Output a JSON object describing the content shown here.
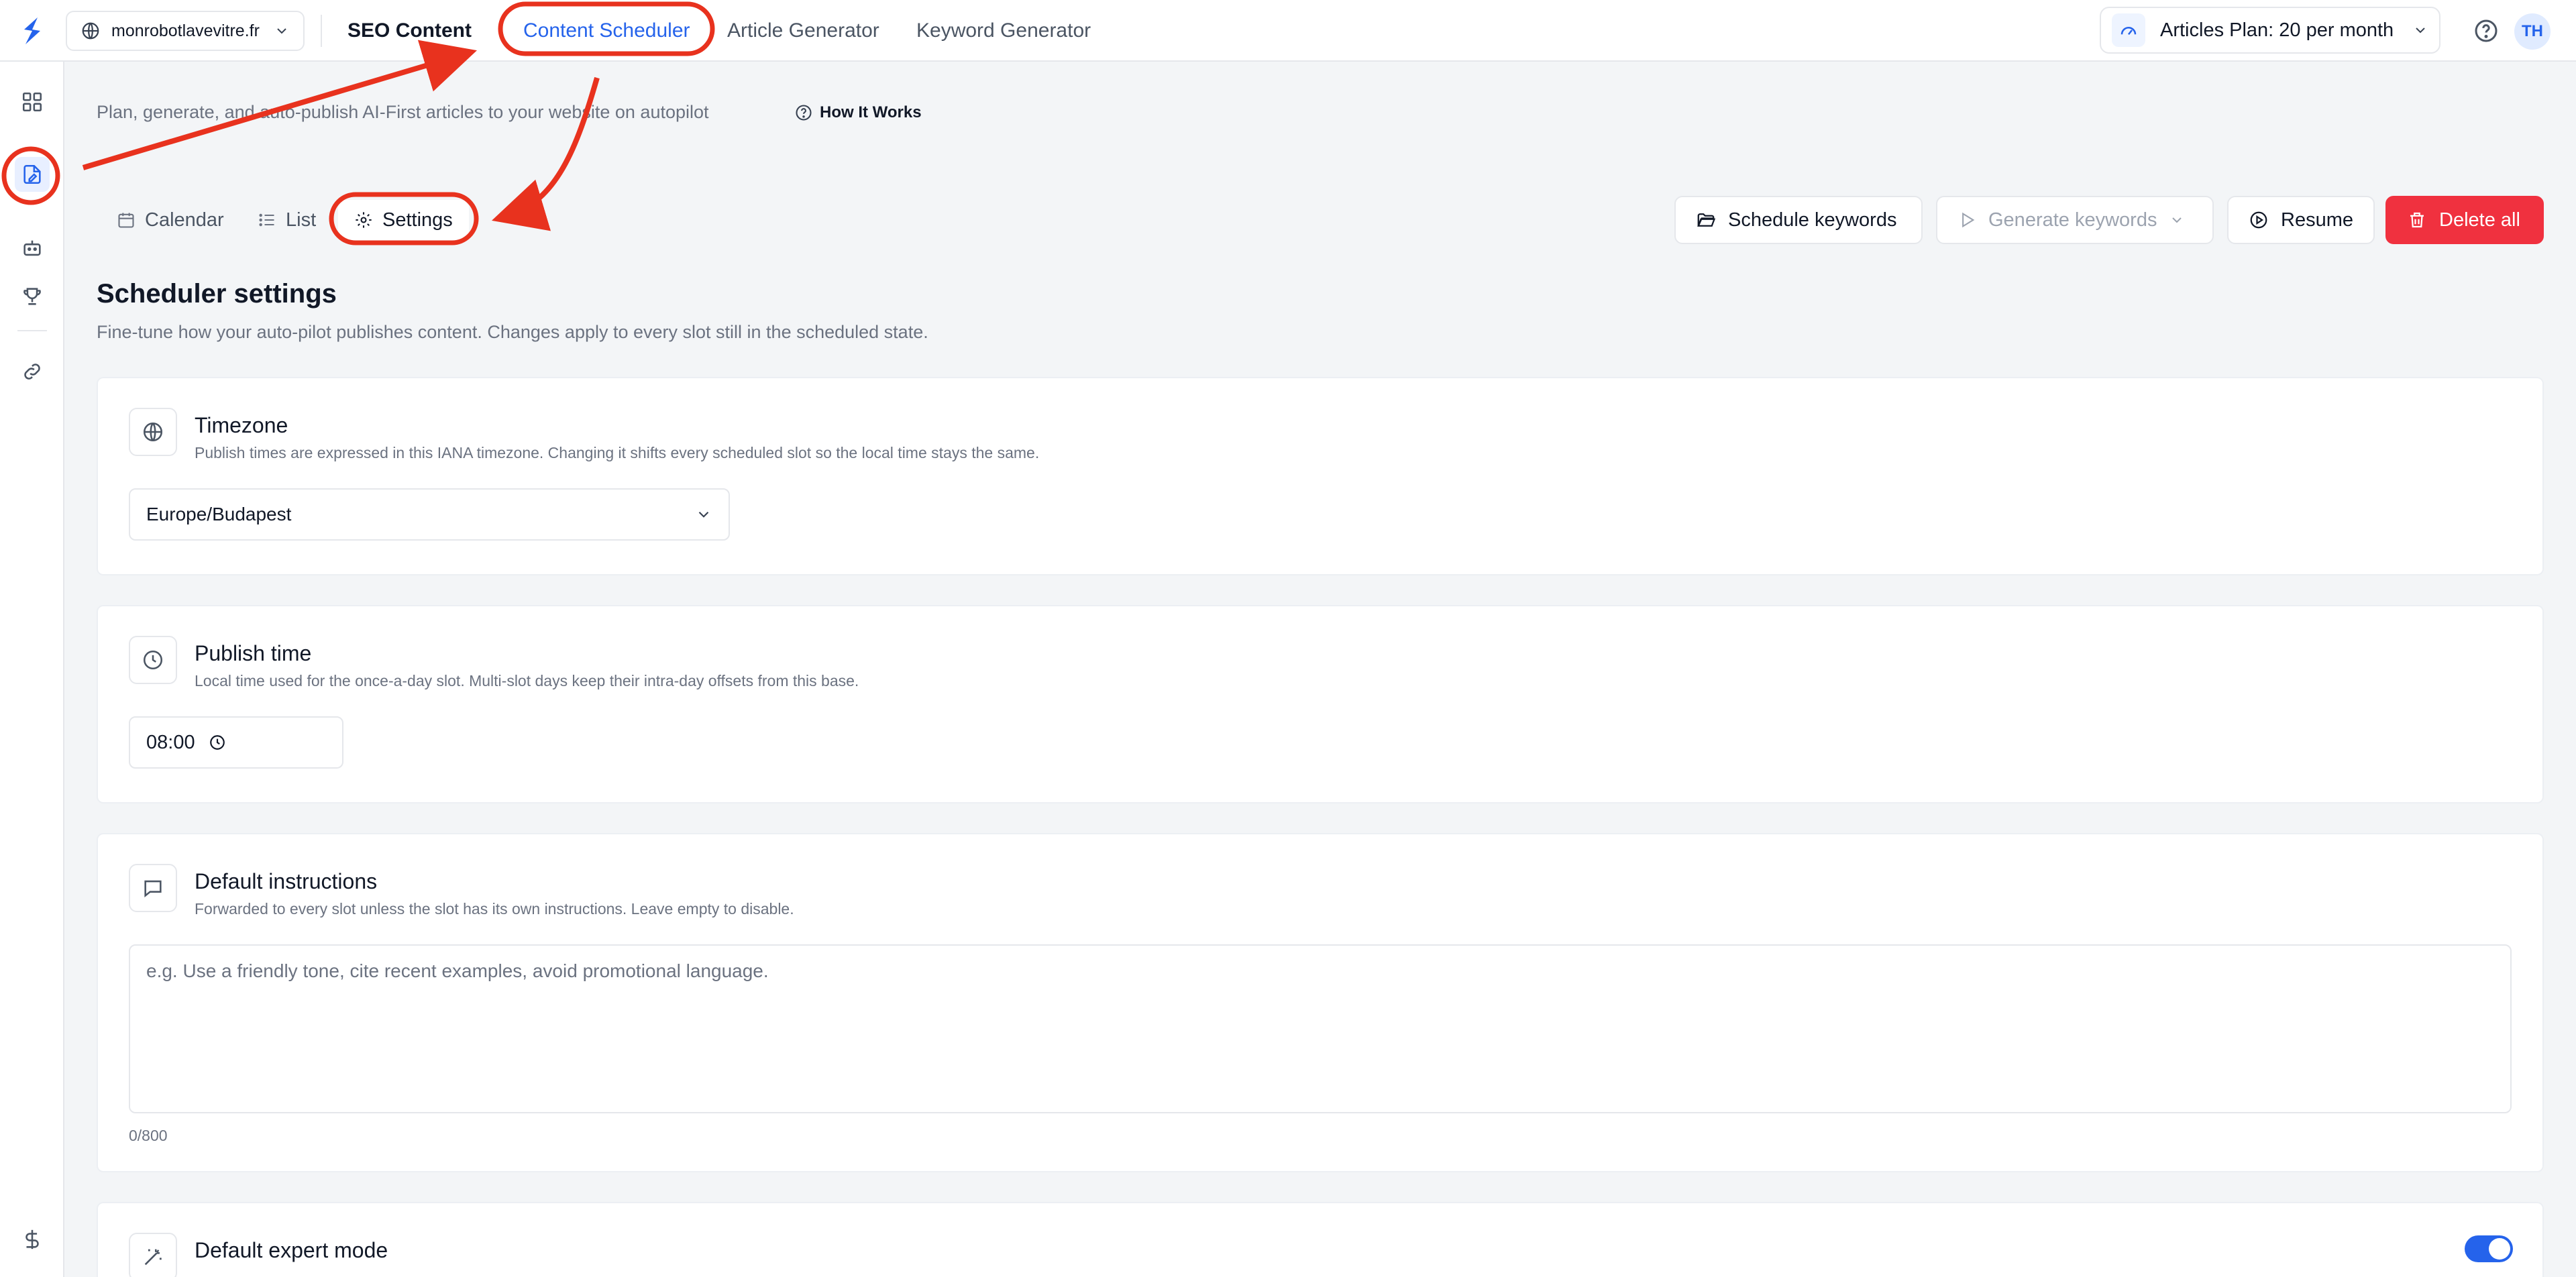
{
  "topbar": {
    "site": "monrobotlavevitre.fr",
    "nav": {
      "seo_content": "SEO Content",
      "content_scheduler": "Content Scheduler",
      "article_generator": "Article Generator",
      "keyword_generator": "Keyword Generator"
    },
    "plan": "Articles Plan: 20 per month",
    "avatar_initials": "TH"
  },
  "sidebar": {
    "icons": [
      "dashboard-icon",
      "article-edit-icon",
      "robot-icon",
      "trophy-icon",
      "link-icon",
      "dollar-icon"
    ],
    "active": "article-edit-icon"
  },
  "main": {
    "subtitle": "Plan, generate, and auto-publish AI-First articles to your website on autopilot",
    "how_it_works": "How It Works",
    "view_tabs": {
      "calendar": "Calendar",
      "list": "List",
      "settings": "Settings"
    },
    "actions": {
      "schedule_keywords": "Schedule keywords",
      "generate_keywords": "Generate keywords",
      "resume": "Resume",
      "delete_all": "Delete all"
    },
    "settings": {
      "title": "Scheduler settings",
      "description": "Fine-tune how your auto-pilot publishes content. Changes apply to every slot still in the scheduled state.",
      "timezone": {
        "title": "Timezone",
        "description": "Publish times are expressed in this IANA timezone. Changing it shifts every scheduled slot so the local time stays the same.",
        "value": "Europe/Budapest"
      },
      "publish_time": {
        "title": "Publish time",
        "description": "Local time used for the once-a-day slot. Multi-slot days keep their intra-day offsets from this base.",
        "value": "08:00"
      },
      "default_instructions": {
        "title": "Default instructions",
        "description": "Forwarded to every slot unless the slot has its own instructions. Leave empty to disable.",
        "placeholder": "e.g. Use a friendly tone, cite recent examples, avoid promotional language.",
        "char_count": "0/800"
      },
      "default_expert_mode": {
        "title": "Default expert mode",
        "enabled": true
      }
    }
  },
  "colors": {
    "accent": "#2563eb",
    "danger": "#f0313f",
    "annotation": "#e8321e"
  }
}
